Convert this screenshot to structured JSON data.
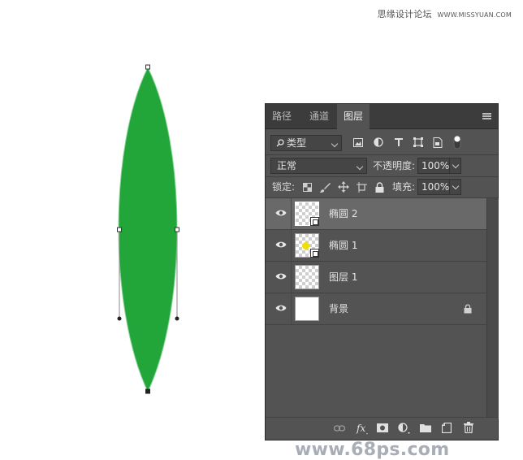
{
  "watermark": {
    "site": "思缘设计论坛",
    "url": "WWW.MISSYUAN.COM"
  },
  "canvas": {
    "shape_color": "#22a63a"
  },
  "panel": {
    "tabs": [
      {
        "label": "路径",
        "active": false
      },
      {
        "label": "通道",
        "active": false
      },
      {
        "label": "图层",
        "active": true
      }
    ],
    "filter": {
      "value": "类型",
      "icons": [
        "image-icon",
        "adjustment-icon",
        "text-icon",
        "shape-icon",
        "smart-object-icon",
        "filter-toggle-icon"
      ]
    },
    "blend_mode": {
      "value": "正常"
    },
    "opacity": {
      "label": "不透明度:",
      "value": "100%"
    },
    "lock": {
      "label": "锁定:",
      "icons": [
        "lock-transparent-icon",
        "lock-paint-icon",
        "lock-move-icon",
        "lock-artboard-icon",
        "lock-all-icon"
      ]
    },
    "fill": {
      "label": "填充:",
      "value": "100%"
    },
    "layers": [
      {
        "name": "椭圆 2",
        "visible": true,
        "selected": true,
        "thumb": "transparent",
        "is_shape": true,
        "locked": false
      },
      {
        "name": "椭圆 1",
        "visible": true,
        "selected": false,
        "thumb": "transparent",
        "is_shape": true,
        "locked": false
      },
      {
        "name": "图层 1",
        "visible": true,
        "selected": false,
        "thumb": "transparent",
        "is_shape": false,
        "locked": false
      },
      {
        "name": "背景",
        "visible": true,
        "selected": false,
        "thumb": "white",
        "is_shape": false,
        "locked": true
      }
    ],
    "watermark_text": "www.68ps.com",
    "bottom_icons": [
      "link-icon",
      "fx-icon",
      "mask-icon",
      "adjustment-layer-icon",
      "folder-icon",
      "new-layer-icon",
      "trash-icon"
    ]
  }
}
